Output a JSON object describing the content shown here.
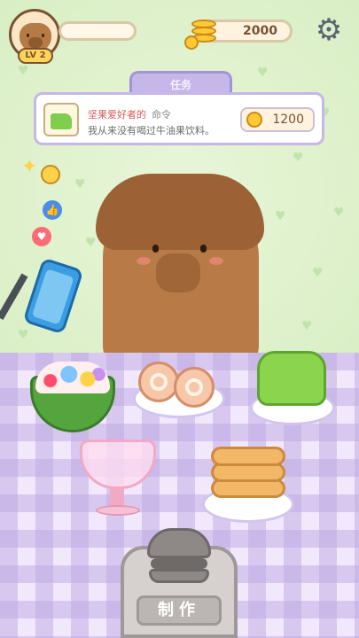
{
  "hud": {
    "level_label": "LV 2",
    "coins": "2000",
    "icons": {
      "coins": "coin-stack-icon",
      "settings": "gear-icon"
    }
  },
  "order": {
    "tab_label": "任务",
    "customer": "坚果爱好者的",
    "order_word": "命令",
    "request": "我从来没有喝过牛油果饮料。",
    "reward": "1200"
  },
  "side_icons": [
    "sparkle-icon",
    "cool-emoji-icon",
    "like-icon",
    "heart-icon",
    "selfie-phone-icon"
  ],
  "dishes": [
    "watermelon-fruit-bowl",
    "strawberry-swiss-roll",
    "green-jelly-cake",
    "fruit-parfait",
    "panda-pancake-stack"
  ],
  "make_button": {
    "label": "制作"
  },
  "colors": {
    "background": "#dcefc9",
    "panel_border": "#c5b7ea",
    "customer_text": "#d85b57",
    "coin": "#ffc933"
  }
}
